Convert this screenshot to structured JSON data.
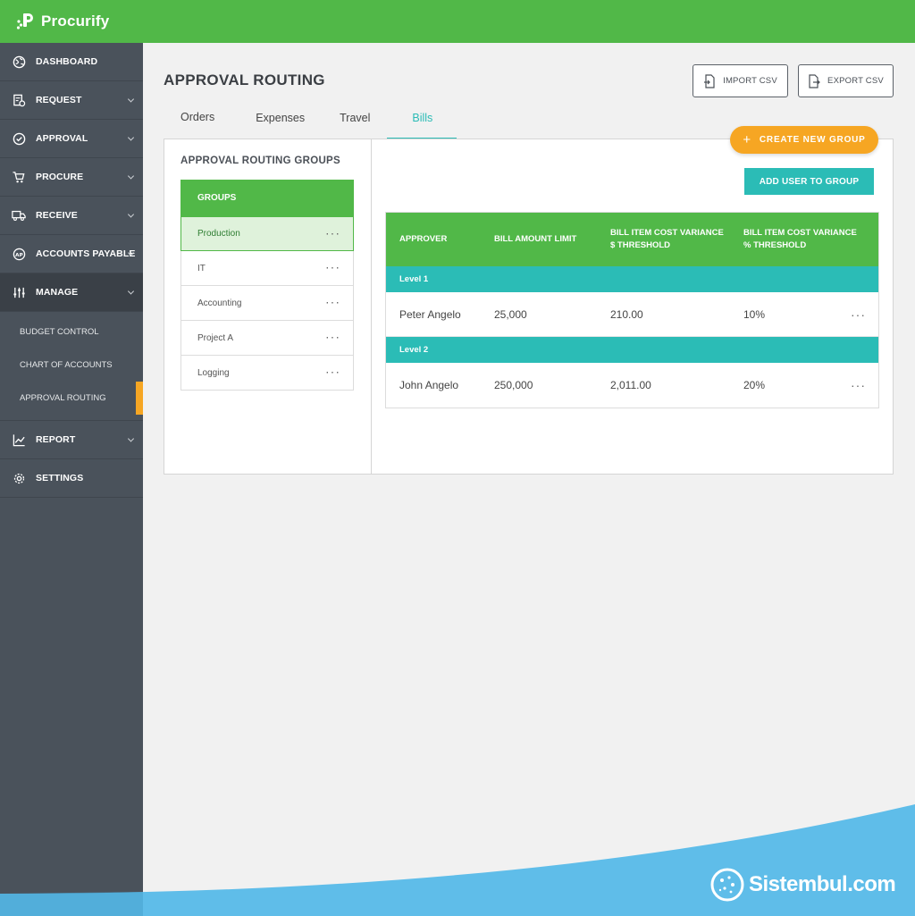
{
  "app": {
    "name": "Procurify"
  },
  "sidebar": {
    "items": [
      {
        "label": "DASHBOARD",
        "icon": "globe-icon"
      },
      {
        "label": "REQUEST",
        "icon": "request-icon"
      },
      {
        "label": "APPROVAL",
        "icon": "check-circle-icon"
      },
      {
        "label": "PROCURE",
        "icon": "cart-icon"
      },
      {
        "label": "RECEIVE",
        "icon": "truck-icon"
      },
      {
        "label": "ACCOUNTS PAYABLE",
        "icon": "ap-icon"
      },
      {
        "label": "MANAGE",
        "icon": "sliders-icon"
      }
    ],
    "manage_sub": [
      {
        "label": "BUDGET CONTROL"
      },
      {
        "label": "CHART OF ACCOUNTS"
      },
      {
        "label": "APPROVAL ROUTING"
      }
    ],
    "bottom_items": [
      {
        "label": "REPORT",
        "icon": "chart-icon"
      },
      {
        "label": "SETTINGS",
        "icon": "gear-icon"
      }
    ]
  },
  "page": {
    "title": "APPROVAL ROUTING",
    "import_label": "IMPORT CSV",
    "export_label": "EXPORT CSV"
  },
  "tabs": [
    {
      "label": "Orders"
    },
    {
      "label": "Expenses"
    },
    {
      "label": "Travel"
    },
    {
      "label": "Bills"
    }
  ],
  "create_group_label": "CREATE NEW GROUP",
  "groups_panel": {
    "title": "APPROVAL ROUTING GROUPS",
    "header": "GROUPS",
    "items": [
      {
        "name": "Production"
      },
      {
        "name": "IT"
      },
      {
        "name": "Accounting"
      },
      {
        "name": "Project A"
      },
      {
        "name": "Logging"
      }
    ]
  },
  "add_user_label": "ADD USER TO GROUP",
  "approvers_table": {
    "columns": [
      "APPROVER",
      "BILL AMOUNT LIMIT",
      "BILL ITEM COST VARIANCE",
      "$ THRESHOLD",
      "BILL ITEM COST VARIANCE",
      "% THRESHOLD"
    ],
    "levels": [
      {
        "label": "Level 1",
        "row": {
          "approver": "Peter Angelo",
          "limit": "25,000",
          "variance_amount": "210.00",
          "variance_pct": "10%"
        }
      },
      {
        "label": "Level 2",
        "row": {
          "approver": "John Angelo",
          "limit": "250,000",
          "variance_amount": "2,011.00",
          "variance_pct": "20%"
        }
      }
    ]
  },
  "watermark": {
    "text": "Sistembul.com"
  },
  "colors": {
    "brand_green": "#51b848",
    "teal": "#2bbcb6",
    "orange": "#f6a623",
    "sidebar": "#4a525b",
    "wave": "#5fbde9"
  }
}
